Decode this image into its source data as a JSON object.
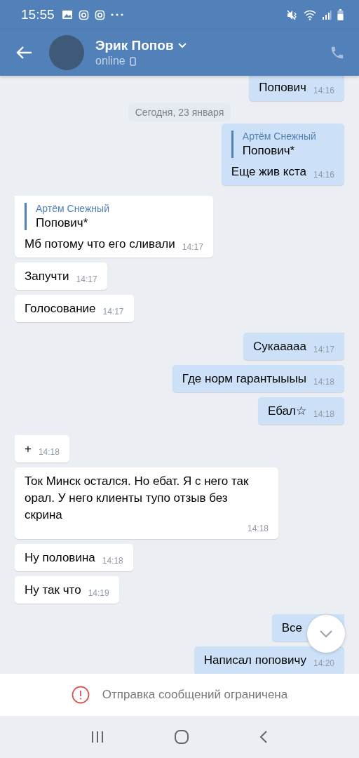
{
  "status_bar": {
    "time": "15:55"
  },
  "header": {
    "name": "Эрик Попов",
    "status": "online"
  },
  "messages": [
    {
      "kind": "message",
      "out": true,
      "tail": false,
      "text": "Попович",
      "time": "14:16"
    },
    {
      "kind": "date",
      "text": "Сегодня, 23 января"
    },
    {
      "kind": "message",
      "out": true,
      "tail": false,
      "reply": {
        "author": "Артём Снежный",
        "text": "Попович*"
      },
      "text": "Еще жив кста",
      "time": "14:16"
    },
    {
      "kind": "message",
      "out": false,
      "tail": true,
      "reply": {
        "author": "Артём Снежный",
        "text": "Попович*"
      },
      "text": "Мб потому что его сливали",
      "time": "14:17"
    },
    {
      "kind": "message",
      "out": false,
      "tail": false,
      "text": "Запучти",
      "time": "14:17"
    },
    {
      "kind": "message",
      "out": false,
      "tail": false,
      "text": "Голосование",
      "time": "14:17"
    },
    {
      "kind": "message",
      "out": true,
      "tail": true,
      "text": "Сукааааа",
      "time": "14:17"
    },
    {
      "kind": "message",
      "out": true,
      "tail": false,
      "text": "Где норм гарантыыыы",
      "time": "14:18"
    },
    {
      "kind": "message",
      "out": true,
      "tail": false,
      "text": "Ебал☆",
      "time": "14:18"
    },
    {
      "kind": "message",
      "out": false,
      "tail": true,
      "text": "+",
      "time": "14:18"
    },
    {
      "kind": "message",
      "out": false,
      "tail": false,
      "text": "Ток Минск остался. Но ебат. Я с него так орал. У него клиенты тупо отзыв без скрина",
      "time": "14:18"
    },
    {
      "kind": "message",
      "out": false,
      "tail": false,
      "text": "Ну половина",
      "time": "14:18"
    },
    {
      "kind": "message",
      "out": false,
      "tail": false,
      "text": "Ну так что",
      "time": "14:19"
    },
    {
      "kind": "message",
      "out": true,
      "tail": true,
      "text": "Все"
    },
    {
      "kind": "message",
      "out": true,
      "tail": false,
      "text": "Написал поповичу",
      "time": "14:20"
    }
  ],
  "notice": {
    "text": "Отправка сообщений ограничена"
  }
}
